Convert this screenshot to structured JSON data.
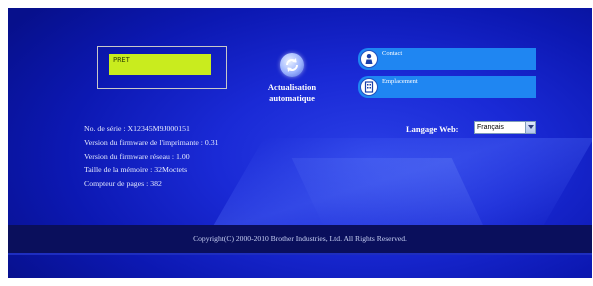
{
  "lcd": {
    "text": "PRET"
  },
  "refresh": {
    "label_line1": "Actualisation",
    "label_line2": "automatique",
    "icon": "refresh-icon"
  },
  "links": [
    {
      "label": "Contact",
      "icon": "contact-person-icon"
    },
    {
      "label": "Emplacement",
      "icon": "location-building-icon"
    }
  ],
  "info": {
    "serial": "No. de série : X12345M9J000151",
    "printer_firmware": "Version du firmware de l'imprimante : 0.31",
    "network_firmware": "Version du firmware réseau : 1.00",
    "memory": "Taille de la mémoire : 32Moctets",
    "page_counter": "Compteur de pages : 382"
  },
  "language": {
    "label": "Langage Web:",
    "selected": "Français"
  },
  "footer": {
    "copyright": "Copyright(C) 2000-2010 Brother Industries, Ltd. All Rights Reserved."
  },
  "colors": {
    "background": "#1a2ad6",
    "lcd": "#c9ec1e",
    "link_button": "#1f86f2",
    "footer": "#0a0f5c"
  }
}
